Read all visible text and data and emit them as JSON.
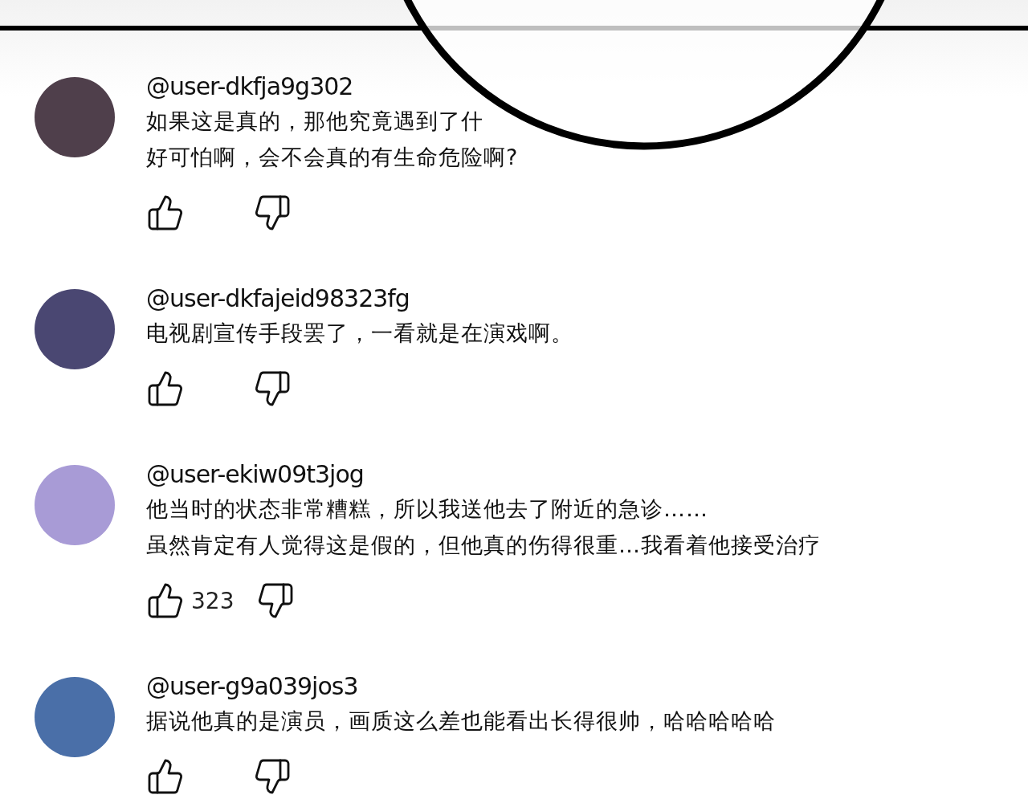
{
  "comments": [
    {
      "user": "@user-dkfja9g302",
      "color": "#4f3f4b",
      "lines": [
        "如果这是真的，那他究竟遇到了什",
        "好可怕啊，会不会真的有生命危险啊?"
      ]
    },
    {
      "user": "@user-dkfajeid98323fg",
      "color": "#4a4772",
      "lines": [
        "电视剧宣传手段罢了，一看就是在演戏啊。"
      ]
    },
    {
      "user": "@user-ekiw09t3jog",
      "color": "#a89bd6",
      "lines": [
        "他当时的状态非常糟糕，所以我送他去了附近的急诊……",
        "虽然肯定有人觉得这是假的，但他真的伤得很重…我看着他接受治疗"
      ],
      "likes": "323"
    },
    {
      "user": "@user-g9a039jos3",
      "color": "#4a6fa8",
      "lines": [
        "据说他真的是演员，画质这么差也能看出长得很帅，哈哈哈哈哈"
      ]
    }
  ]
}
